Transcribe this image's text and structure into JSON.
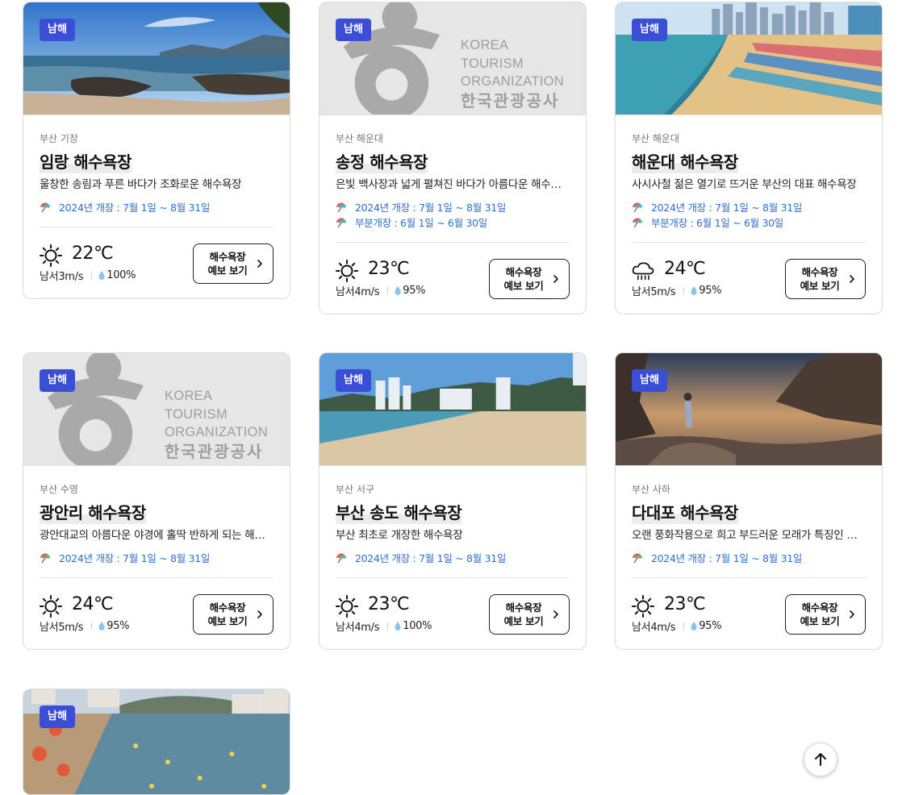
{
  "cards": [
    {
      "badge": "남해",
      "region": "부산 기장",
      "title": "임랑 해수욕장",
      "desc": "울창한 송림과 푸른 바다가 조화로운 해수욕장",
      "openings": [
        "2024년 개장 : 7월 1일 ~ 8월 31일"
      ],
      "weather_icon": "sun-icon",
      "temp": "22℃",
      "wind": "남서3m/s",
      "humidity": "100%",
      "btn_line1": "해수욕장",
      "btn_line2": "예보 보기",
      "image": "rocky-coast-photo"
    },
    {
      "badge": "남해",
      "region": "부산 해운대",
      "title": "송정 해수욕장",
      "desc": "은빛 백사장과 넓게 펼쳐진 바다가 아름다운 해수욕장",
      "openings": [
        "2024년 개장 : 7월 1일 ~ 8월 31일",
        "부분개장 : 6월 1일 ~ 6월 30일"
      ],
      "weather_icon": "sun-icon",
      "temp": "23℃",
      "wind": "남서4m/s",
      "humidity": "95%",
      "btn_line1": "해수욕장",
      "btn_line2": "예보 보기",
      "image": "kto-placeholder"
    },
    {
      "badge": "남해",
      "region": "부산 해운대",
      "title": "해운대 해수욕장",
      "desc": "사시사철 젊은 열기로 뜨거운 부산의 대표 해수욕장",
      "openings": [
        "2024년 개장 : 7월 1일 ~ 8월 31일",
        "부분개장 : 6월 1일 ~ 6월 30일"
      ],
      "weather_icon": "rain-cloud-icon",
      "temp": "24℃",
      "wind": "남서5m/s",
      "humidity": "95%",
      "btn_line1": "해수욕장",
      "btn_line2": "예보 보기",
      "image": "city-beach-photo"
    },
    {
      "badge": "남해",
      "region": "부산 수영",
      "title": "광안리 해수욕장",
      "desc": "광안대교의 아름다운 야경에 홀딱 반하게 되는 해수욕장",
      "openings": [
        "2024년 개장 : 7월 1일 ~ 8월 31일"
      ],
      "weather_icon": "sun-icon",
      "temp": "24℃",
      "wind": "남서5m/s",
      "humidity": "95%",
      "btn_line1": "해수욕장",
      "btn_line2": "예보 보기",
      "image": "kto-placeholder"
    },
    {
      "badge": "남해",
      "region": "부산 서구",
      "title": "부산 송도 해수욕장",
      "desc": "부산 최초로 개장한 해수욕장",
      "openings": [
        "2024년 개장 : 7월 1일 ~ 8월 31일"
      ],
      "weather_icon": "sun-icon",
      "temp": "23℃",
      "wind": "남서4m/s",
      "humidity": "100%",
      "btn_line1": "해수욕장",
      "btn_line2": "예보 보기",
      "image": "songdo-beach-photo"
    },
    {
      "badge": "남해",
      "region": "부산 사하",
      "title": "다대포 해수욕장",
      "desc": "오랜 풍화작용으로 희고 부드러운 모래가 특징인 해수욕장",
      "openings": [
        "2024년 개장 : 7월 1일 ~ 8월 31일"
      ],
      "weather_icon": "sun-icon",
      "temp": "23℃",
      "wind": "남서4m/s",
      "humidity": "95%",
      "btn_line1": "해수욕장",
      "btn_line2": "예보 보기",
      "image": "sunset-rocks-photo"
    },
    {
      "badge": "남해",
      "image": "crowded-beach-photo"
    }
  ],
  "placeholder_logo": {
    "line1": "KOREA",
    "line2": "TOURISM",
    "line3": "ORGANIZATION",
    "line4": "한국관광공사"
  },
  "scroll_top": {
    "icon": "arrow-up-icon"
  },
  "colors": {
    "badge": "#3a4fd6",
    "link": "#2e6fd0"
  }
}
